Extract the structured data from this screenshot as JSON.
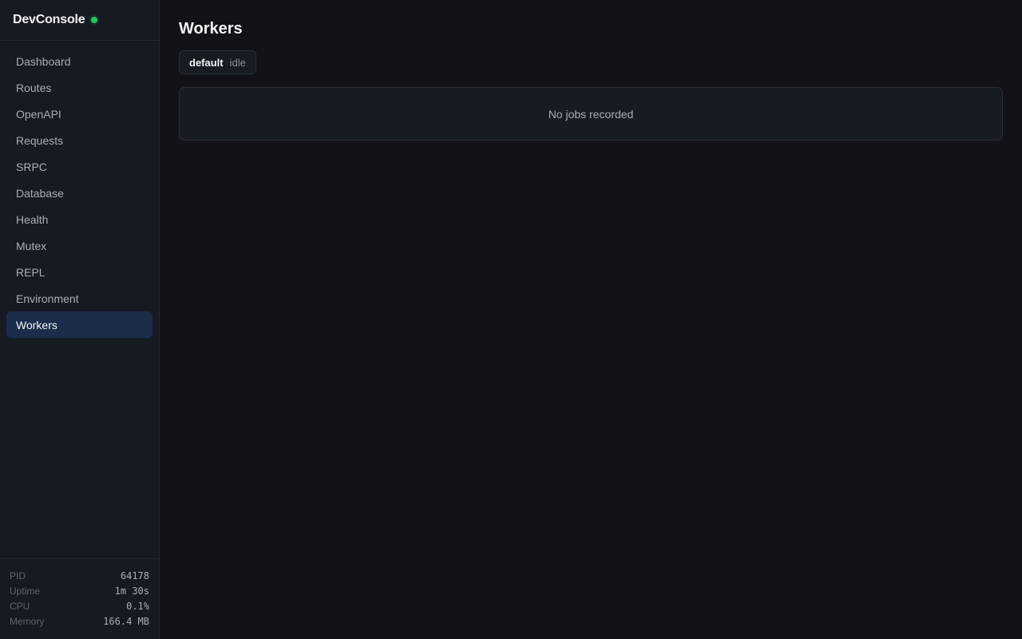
{
  "app": {
    "name": "DevConsole",
    "status_color": "#22c55e"
  },
  "sidebar": {
    "items": [
      {
        "label": "Dashboard",
        "active": false
      },
      {
        "label": "Routes",
        "active": false
      },
      {
        "label": "OpenAPI",
        "active": false
      },
      {
        "label": "Requests",
        "active": false
      },
      {
        "label": "SRPC",
        "active": false
      },
      {
        "label": "Database",
        "active": false
      },
      {
        "label": "Health",
        "active": false
      },
      {
        "label": "Mutex",
        "active": false
      },
      {
        "label": "REPL",
        "active": false
      },
      {
        "label": "Environment",
        "active": false
      },
      {
        "label": "Workers",
        "active": true
      }
    ],
    "stats": [
      {
        "label": "PID",
        "value": "64178"
      },
      {
        "label": "Uptime",
        "value": "1m 30s"
      },
      {
        "label": "CPU",
        "value": "0.1%"
      },
      {
        "label": "Memory",
        "value": "166.4 MB"
      }
    ]
  },
  "main": {
    "title": "Workers",
    "workers": [
      {
        "name": "default",
        "status": "idle"
      }
    ],
    "jobs": {
      "empty_message": "No jobs recorded"
    }
  },
  "colors": {
    "active_nav": "#1b2d4a",
    "background": "#111318",
    "panel": "#171b22"
  }
}
